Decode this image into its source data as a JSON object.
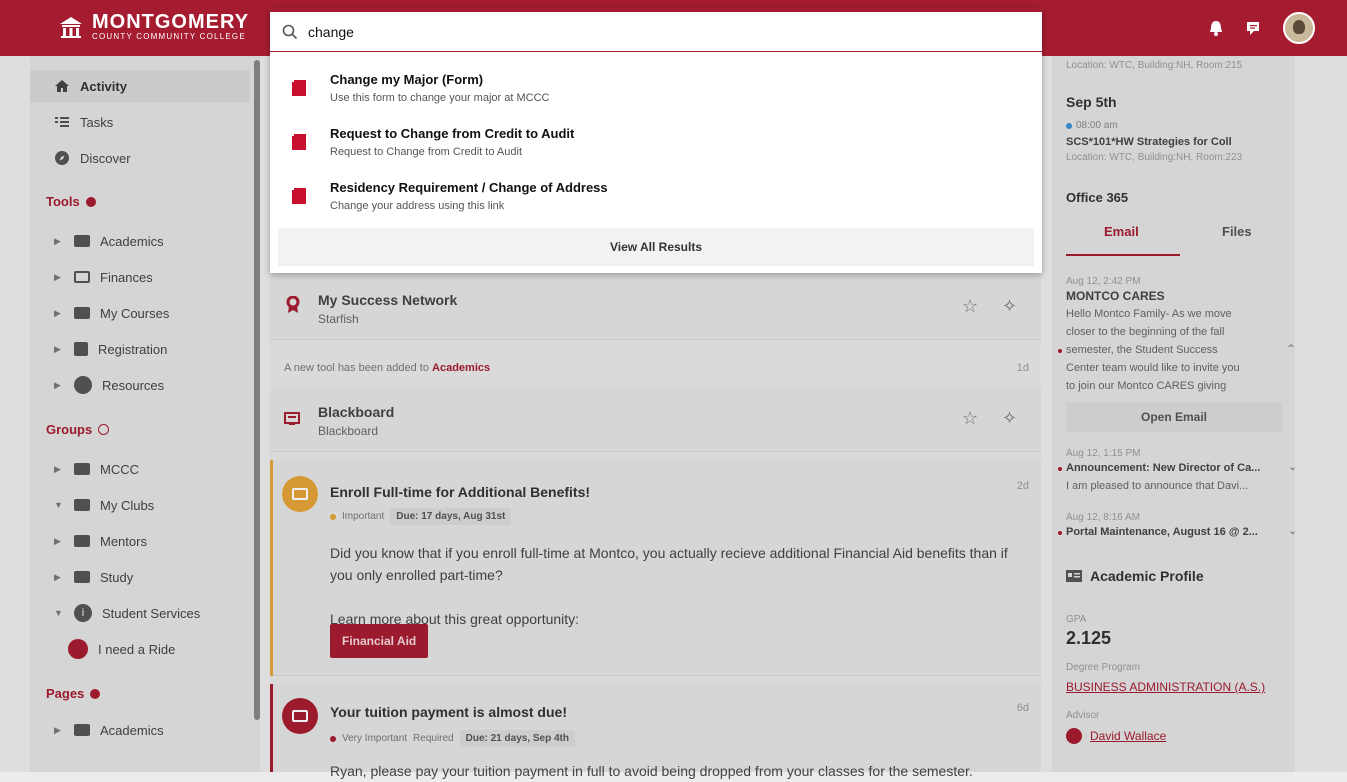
{
  "header": {
    "logo_line1": "MONTGOMERY",
    "logo_line2": "COUNTY COMMUNITY COLLEGE"
  },
  "sidebar": {
    "nav": [
      {
        "label": "Activity",
        "icon": "home-icon",
        "active": true
      },
      {
        "label": "Tasks",
        "icon": "list-icon"
      },
      {
        "label": "Discover",
        "icon": "compass-icon"
      }
    ],
    "tools_heading": "Tools",
    "tools": [
      "Academics",
      "Finances",
      "My Courses",
      "Registration",
      "Resources"
    ],
    "groups_heading": "Groups",
    "groups": [
      "MCCC",
      "My Clubs",
      "Mentors",
      "Study",
      "Student Services",
      "I need a Ride"
    ],
    "pages_heading": "Pages",
    "pages": [
      "Academics"
    ]
  },
  "search": {
    "query": "change",
    "results": [
      {
        "title": "Change my Major (Form)",
        "desc": "Use this form to change your major at MCCC"
      },
      {
        "title": "Request to Change from Credit to Audit",
        "desc": "Request to Change from Credit to Audit"
      },
      {
        "title": "Residency Requirement / Change of Address",
        "desc": "Change your address using this link"
      }
    ],
    "view_all": "View All Results"
  },
  "feed": {
    "tool1": {
      "title": "My Success Network",
      "subtitle": "Starfish"
    },
    "notice": {
      "prefix": "A new tool has been added to ",
      "target": "Academics",
      "time": "1d"
    },
    "tool2": {
      "title": "Blackboard",
      "subtitle": "Blackboard"
    },
    "event1": {
      "title": "Enroll Full-time for Additional Benefits!",
      "time": "2d",
      "priority": "Important",
      "due": "Due: 17 days, Aug 31st",
      "body1": "Did you know that if you enroll full-time at Montco, you actually recieve additional Financial Aid benefits than if you only enrolled part-time?",
      "body2": "Learn more about this great opportunity:",
      "button": "Financial Aid"
    },
    "event2": {
      "title": "Your tuition payment is almost due!",
      "time": "6d",
      "priority": "Very Important",
      "required": "Required",
      "due": "Due: 21 days, Sep 4th",
      "body": "Ryan, please pay your tuition payment in full to avoid being dropped from your classes for the semester."
    }
  },
  "right": {
    "location1": "Location: WTC, Building:NH, Room:215",
    "date": "Sep 5th",
    "time": "08:00 am",
    "course": "SCS*101*HW Strategies for Coll",
    "location2": "Location: WTC, Building:NH, Room:223",
    "office_heading": "Office 365",
    "tab_email": "Email",
    "tab_files": "Files",
    "email1": {
      "time": "Aug 12, 2:42 PM",
      "from": "MONTCO CARES",
      "lines": [
        "Hello Montco Family- As we move",
        "closer to the beginning of the fall",
        "semester, the Student Success",
        "Center team would like to invite you",
        "to join our Montco CARES giving"
      ]
    },
    "open_email": "Open Email",
    "email2": {
      "time": "Aug 12, 1:15 PM",
      "subject": "Announcement: New Director of Ca...",
      "preview": "I am pleased to announce that Davi..."
    },
    "email3": {
      "time": "Aug 12, 8:16 AM",
      "subject": "Portal Maintenance, August 16 @ 2..."
    },
    "profile_heading": "Academic Profile",
    "gpa_label": "GPA",
    "gpa": "2.125",
    "degree_label": "Degree Program",
    "degree": "BUSINESS ADMINISTRATION (A.S.)",
    "advisor_label": "Advisor",
    "advisor": "David Wallace"
  },
  "colors": {
    "brand": "#a51c30",
    "warning": "#e5a33a"
  }
}
